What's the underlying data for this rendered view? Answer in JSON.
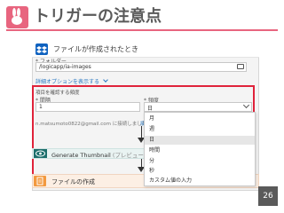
{
  "slide": {
    "title": "トリガーの注意点",
    "page_number": "26",
    "accent_color": "#e8657f"
  },
  "trigger": {
    "title": "ファイルが作成されたとき",
    "folder_label": "* フォルダー",
    "folder_value": "/logicapp/ia-images",
    "advanced_options_label": "詳細オプションを表示する",
    "check_section_label": "項目を確認する頻度",
    "interval_label": "* 間隔",
    "interval_value": "1",
    "frequency_label": "* 頻度",
    "frequency_value": "日",
    "connection_text": "n.matsumoto0822@gmail.com に接続しました。",
    "change_connection_label": "接続"
  },
  "frequency_dropdown": {
    "options": [
      "月",
      "週",
      "日",
      "時間",
      "分",
      "秒",
      "カスタム値の入力"
    ],
    "selected": "日"
  },
  "actions": [
    {
      "title": "Generate Thumbnail",
      "subtitle": "(プレビュー)"
    },
    {
      "title": "ファイルの作成"
    }
  ],
  "colors": {
    "highlight_border": "#e0233b",
    "dropbox": "#0f62c0",
    "cognitive_services": "#1c6f6c",
    "file_action": "#f2993f",
    "link": "#2b79c2"
  },
  "icons": {
    "logo": "rabbit-logo-icon",
    "dropbox": "dropbox-icon",
    "folder": "folder-icon",
    "cognitive": "eye-icon",
    "file": "file-icon"
  }
}
